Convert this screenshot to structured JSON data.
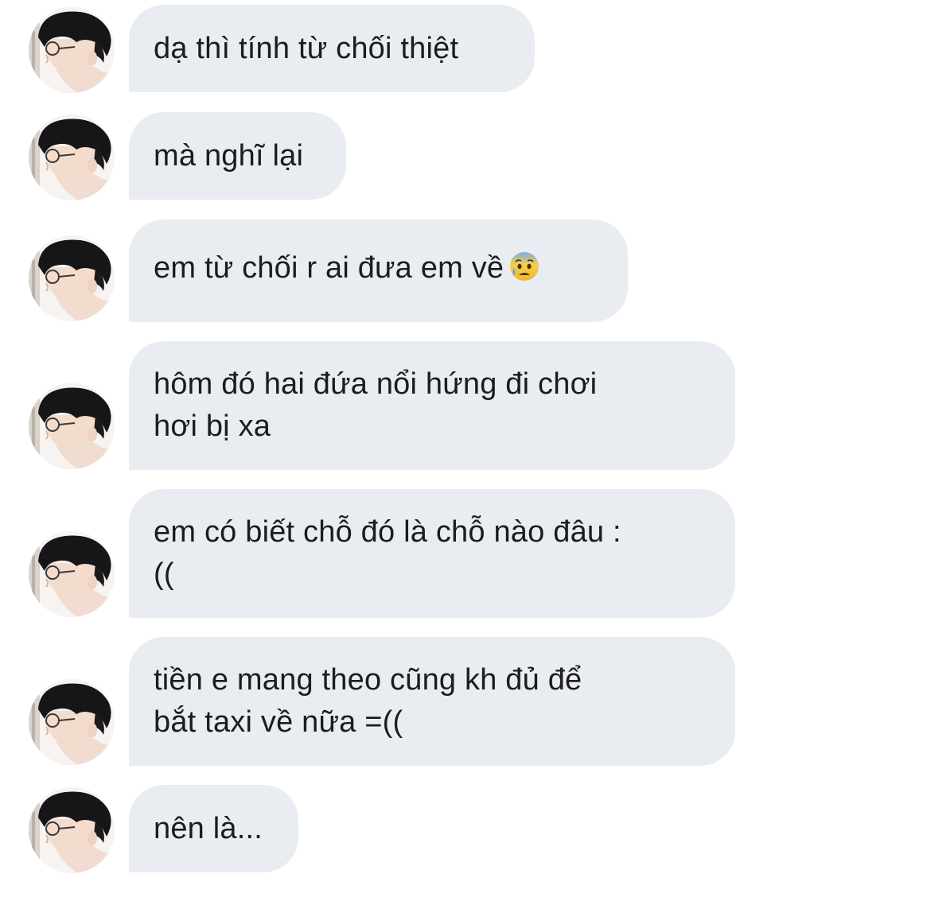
{
  "chat": {
    "messages": [
      {
        "text": "dạ thì tính từ chối thiệt",
        "emoji": ""
      },
      {
        "text": "mà nghĩ lại",
        "emoji": ""
      },
      {
        "text": "em từ chối r ai đưa em về",
        "emoji": "anxious-face-with-sweat-icon"
      },
      {
        "text": "hôm đó hai đứa nổi hứng đi chơi\nhơi bị xa",
        "emoji": ""
      },
      {
        "text": "em có biết chỗ đó là chỗ nào đâu :\n((",
        "emoji": ""
      },
      {
        "text": "tiền e mang theo cũng kh đủ để\nbắt taxi về nữa =((",
        "emoji": ""
      },
      {
        "text": "nên là...",
        "emoji": ""
      }
    ]
  },
  "colors": {
    "bubble": "#e9ecf1",
    "text": "#1c1c1e",
    "background": "#ffffff"
  }
}
